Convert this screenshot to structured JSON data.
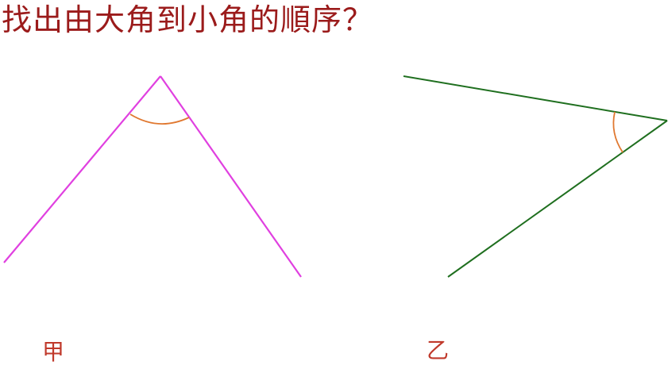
{
  "question": {
    "text": "找出由大角到小角的順序？",
    "color": "#9b1b1b"
  },
  "figures": [
    {
      "label": "甲",
      "line_color": "#e040e0",
      "arc_color": "#e07830"
    },
    {
      "label": "乙",
      "line_color": "#1f6f1f",
      "arc_color": "#e07830"
    }
  ],
  "label_color": "#c0392b"
}
